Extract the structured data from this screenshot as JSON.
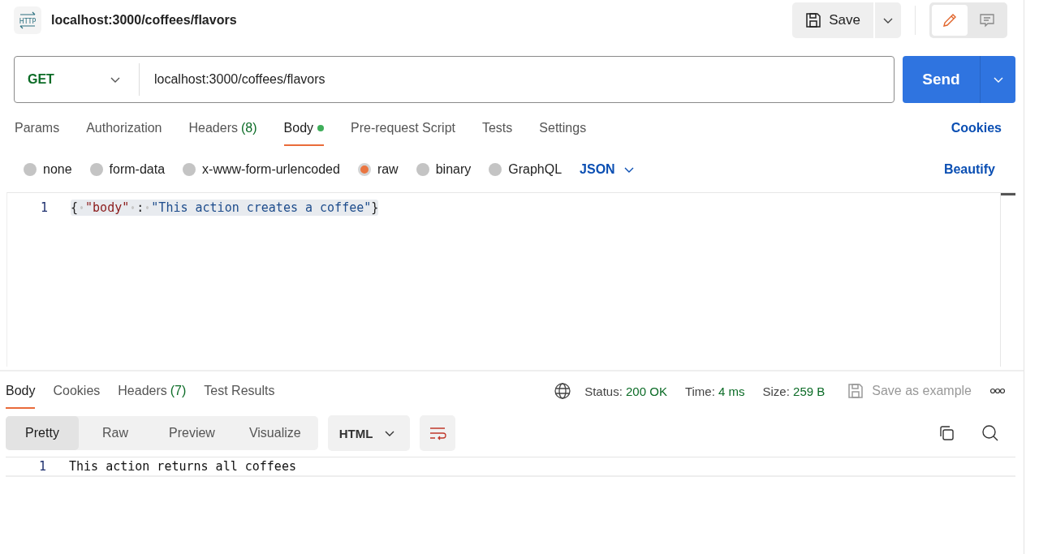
{
  "header": {
    "logo_text": "HTTP",
    "title": "localhost:3000/coffees/flavors",
    "save_label": "Save",
    "modes": [
      {
        "kind": "edit",
        "selected": true
      },
      {
        "kind": "comment",
        "selected": false
      }
    ]
  },
  "request": {
    "method": "GET",
    "url": "localhost:3000/coffees/flavors",
    "send_label": "Send"
  },
  "request_tabs": [
    {
      "label": "Params",
      "selected": false
    },
    {
      "label": "Authorization",
      "selected": false
    },
    {
      "label": "Headers",
      "count": "(8)",
      "selected": false
    },
    {
      "label": "Body",
      "dot": true,
      "selected": true
    },
    {
      "label": "Pre-request Script",
      "selected": false
    },
    {
      "label": "Tests",
      "selected": false
    },
    {
      "label": "Settings",
      "selected": false
    }
  ],
  "cookies_link": "Cookies",
  "body_types": [
    {
      "label": "none",
      "selected": false
    },
    {
      "label": "form-data",
      "selected": false
    },
    {
      "label": "x-www-form-urlencoded",
      "selected": false
    },
    {
      "label": "raw",
      "selected": true
    },
    {
      "label": "binary",
      "selected": false
    },
    {
      "label": "GraphQL",
      "selected": false
    }
  ],
  "raw_format": "JSON",
  "beautify_link": "Beautify",
  "editor": {
    "lines": [
      {
        "number": "1",
        "tokens": [
          {
            "kind": "punct",
            "text": "{"
          },
          {
            "kind": "space"
          },
          {
            "kind": "key",
            "text": "\"body\""
          },
          {
            "kind": "space"
          },
          {
            "kind": "punct",
            "text": ":"
          },
          {
            "kind": "space"
          },
          {
            "kind": "string",
            "text": "\"This action creates a coffee\""
          },
          {
            "kind": "punct",
            "text": "}"
          }
        ]
      }
    ]
  },
  "response_tabs": [
    {
      "label": "Body",
      "selected": true
    },
    {
      "label": "Cookies",
      "selected": false
    },
    {
      "label": "Headers",
      "count": "(7)",
      "selected": false
    },
    {
      "label": "Test Results",
      "selected": false
    }
  ],
  "status": [
    {
      "label": "Status:",
      "value": "200 OK"
    },
    {
      "label": "Time:",
      "value": "4 ms"
    },
    {
      "label": "Size:",
      "value": "259 B"
    }
  ],
  "save_example": {
    "label": "Save as example",
    "disabled": true
  },
  "view_modes": [
    {
      "label": "Pretty",
      "selected": true
    },
    {
      "label": "Raw",
      "selected": false
    },
    {
      "label": "Preview",
      "selected": false
    },
    {
      "label": "Visualize",
      "selected": false
    }
  ],
  "response_format": "HTML",
  "response_lines": [
    {
      "number": "1",
      "text": "This action returns all coffees"
    }
  ]
}
